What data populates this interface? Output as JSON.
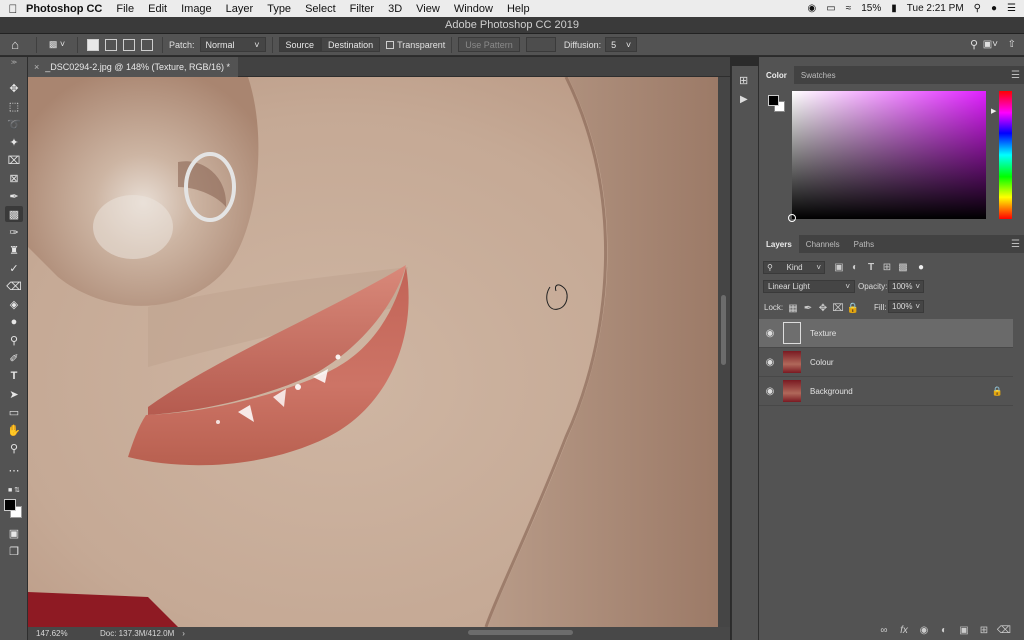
{
  "menubar": {
    "app_name": "Photoshop CC",
    "items": [
      "File",
      "Edit",
      "Image",
      "Layer",
      "Type",
      "Select",
      "Filter",
      "3D",
      "View",
      "Window",
      "Help"
    ],
    "battery": "15%",
    "clock": "Tue 2:21 PM"
  },
  "window": {
    "title": "Adobe Photoshop CC 2019"
  },
  "options": {
    "patch_label": "Patch:",
    "patch_value": "Normal",
    "source_label": "Source",
    "destination_label": "Destination",
    "transparent_label": "Transparent",
    "use_pattern_label": "Use Pattern",
    "diffusion_label": "Diffusion:",
    "diffusion_value": "5"
  },
  "document": {
    "tab_title": "_DSC0294-2.jpg @ 148% (Texture, RGB/16) *",
    "zoom": "147.62%",
    "doc_size": "Doc: 137.3M/412.0M"
  },
  "color_panel": {
    "tabs": [
      "Color",
      "Swatches"
    ],
    "foreground": "#000000",
    "background": "#ffffff",
    "hue_color": "#e020ff"
  },
  "layers_panel": {
    "tabs": [
      "Layers",
      "Channels",
      "Paths"
    ],
    "filter_kind": "Kind",
    "blend_mode": "Linear Light",
    "opacity_label": "Opacity:",
    "opacity_value": "100%",
    "lock_label": "Lock:",
    "fill_label": "Fill:",
    "fill_value": "100%",
    "layers": [
      {
        "name": "Texture",
        "selected": true,
        "locked": false
      },
      {
        "name": "Colour",
        "selected": false,
        "locked": false
      },
      {
        "name": "Background",
        "selected": false,
        "locked": true
      }
    ]
  },
  "colors": {
    "accent_hue_top": "#ff00ff",
    "skin": "#c8a994",
    "lips": "#c96b5d"
  }
}
